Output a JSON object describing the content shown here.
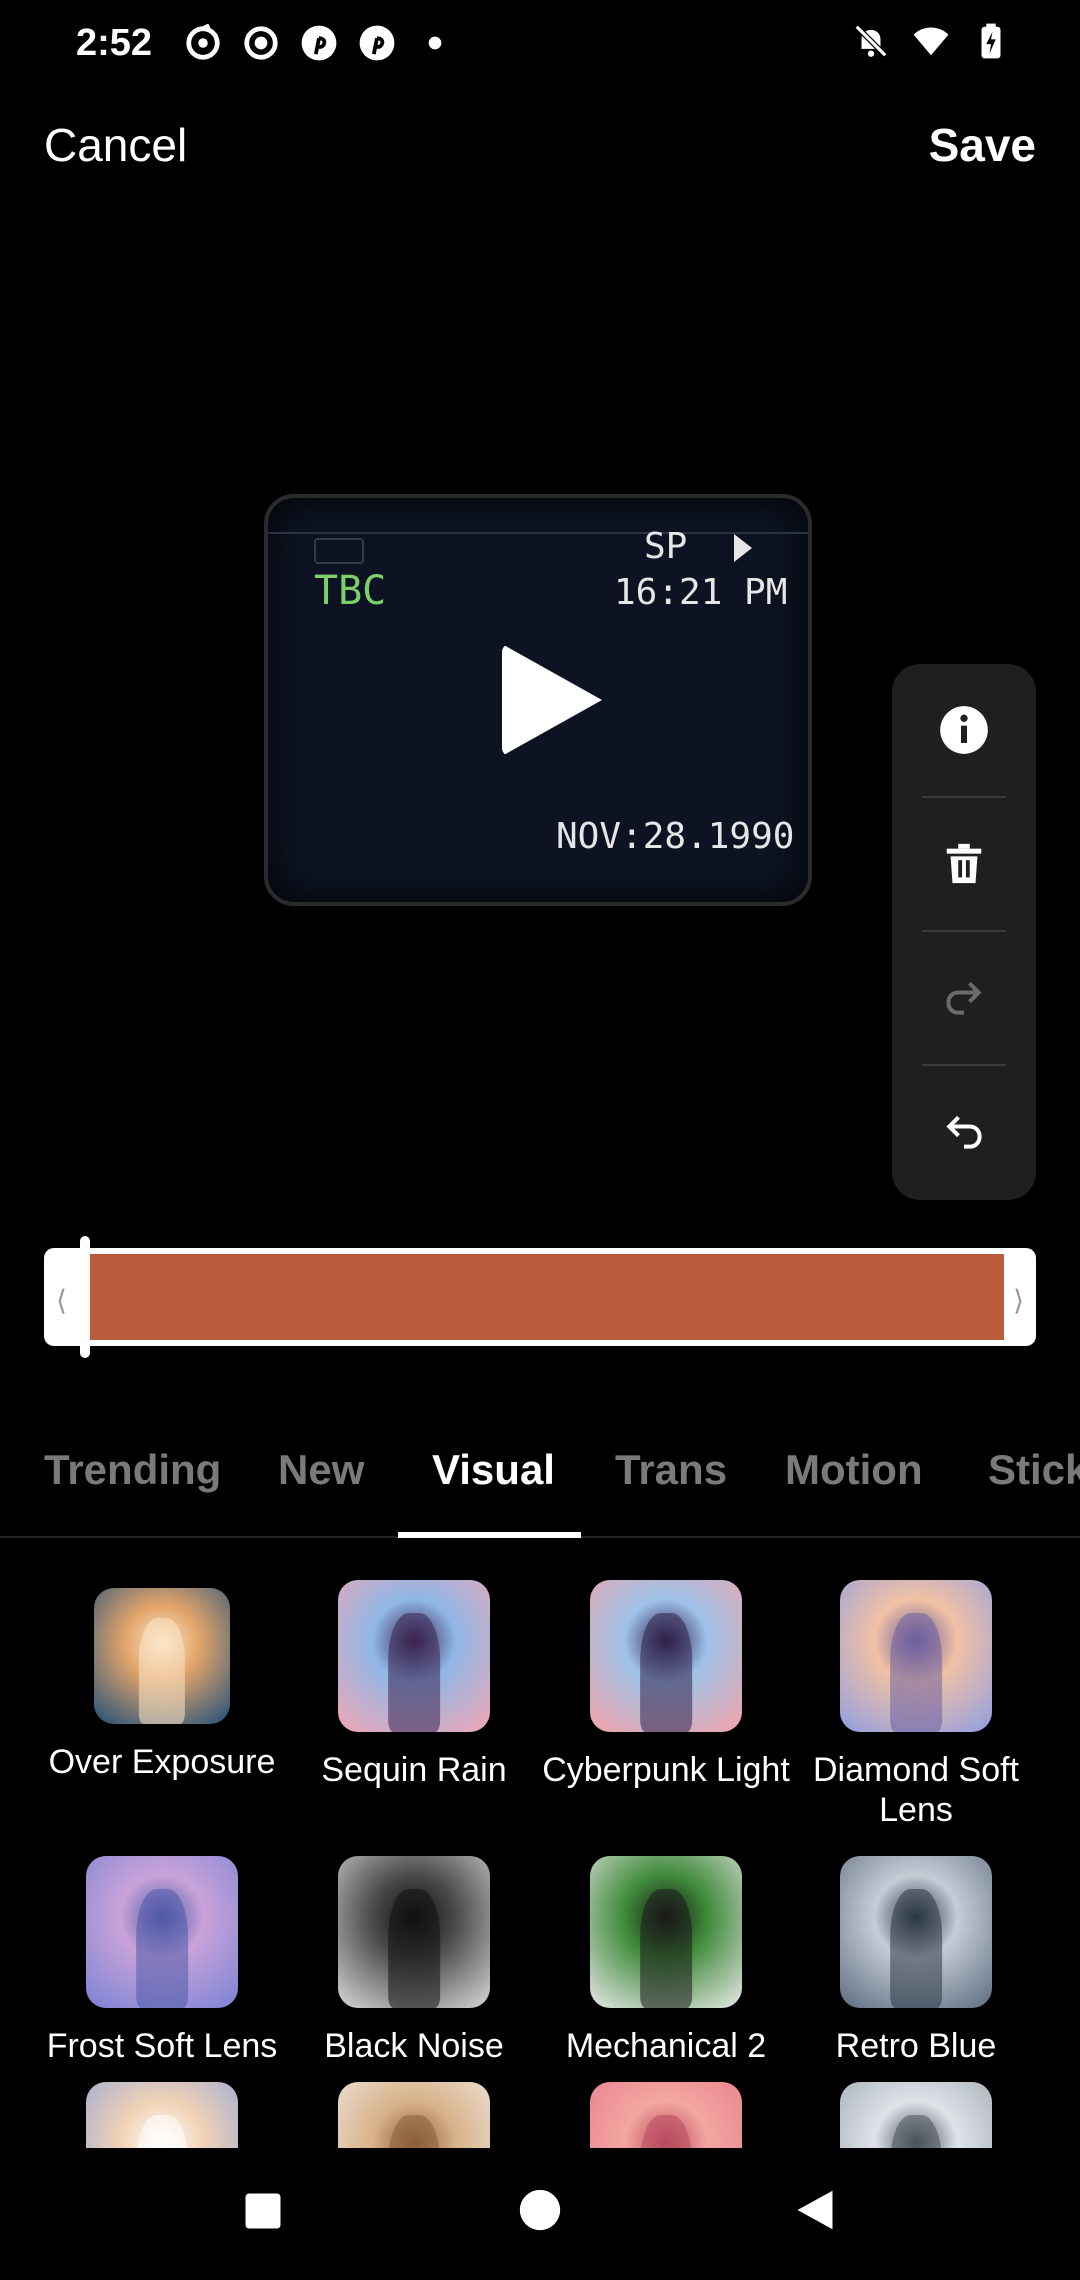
{
  "status_bar": {
    "time": "2:52",
    "left_icons": [
      "sync-icon",
      "record-icon",
      "pinterest-icon",
      "pinterest-icon",
      "dot-icon"
    ],
    "right_icons": [
      "bell-off-icon",
      "wifi-icon",
      "battery-charging-icon"
    ]
  },
  "header": {
    "cancel_label": "Cancel",
    "save_label": "Save"
  },
  "video": {
    "overlay_tbc": "TBC",
    "overlay_sp": "SP",
    "overlay_time": "16:21 PM",
    "overlay_date": "NOV:28.1990"
  },
  "side_tools": [
    "info-icon",
    "trash-icon",
    "redo-icon",
    "undo-icon"
  ],
  "timeline": {
    "color": "#b95c3b",
    "left_handle": "⟨",
    "right_handle": "⟩"
  },
  "tabs": {
    "items": [
      "Trending",
      "New",
      "Visual",
      "Trans",
      "Motion",
      "Stick"
    ],
    "active": "Visual"
  },
  "effects": [
    {
      "label": "Over Exposure",
      "colors": [
        "#1d4f7a",
        "#e2a46a",
        "#fbe6c8"
      ]
    },
    {
      "label": "Sequin Rain",
      "colors": [
        "#f3a6b4",
        "#8fb7e6",
        "#3a2350"
      ]
    },
    {
      "label": "Cyberpunk Light",
      "colors": [
        "#f4a3a8",
        "#9ec2e8",
        "#30204b"
      ]
    },
    {
      "label": "Diamond Soft Lens",
      "colors": [
        "#8f9ee2",
        "#f1c1a4",
        "#6b5e9e"
      ]
    },
    {
      "label": "Frost Soft Lens",
      "colors": [
        "#7a83d6",
        "#c9a3d8",
        "#4e5aa8"
      ]
    },
    {
      "label": "Black Noise",
      "colors": [
        "#d9d9d9",
        "#4a4a4a",
        "#111111"
      ]
    },
    {
      "label": "Mechanical 2",
      "colors": [
        "#e9e9e9",
        "#3f8a3a",
        "#1a1a1a"
      ]
    },
    {
      "label": "Retro Blue",
      "colors": [
        "#5d6c80",
        "#c5ccd6",
        "#2b3646"
      ]
    },
    {
      "label": "",
      "colors": [
        "#8ea4d8",
        "#f1d2b6",
        "#ffffff"
      ]
    },
    {
      "label": "",
      "colors": [
        "#f1ede8",
        "#d8b28a",
        "#8a5e3c"
      ]
    },
    {
      "label": "",
      "colors": [
        "#e67a8f",
        "#f3a6a0",
        "#b84a5f"
      ]
    },
    {
      "label": "",
      "colors": [
        "#9aa3ad",
        "#dfe3e8",
        "#4a525c"
      ]
    }
  ],
  "navbar": [
    "square-icon",
    "circle-icon",
    "back-triangle-icon"
  ]
}
